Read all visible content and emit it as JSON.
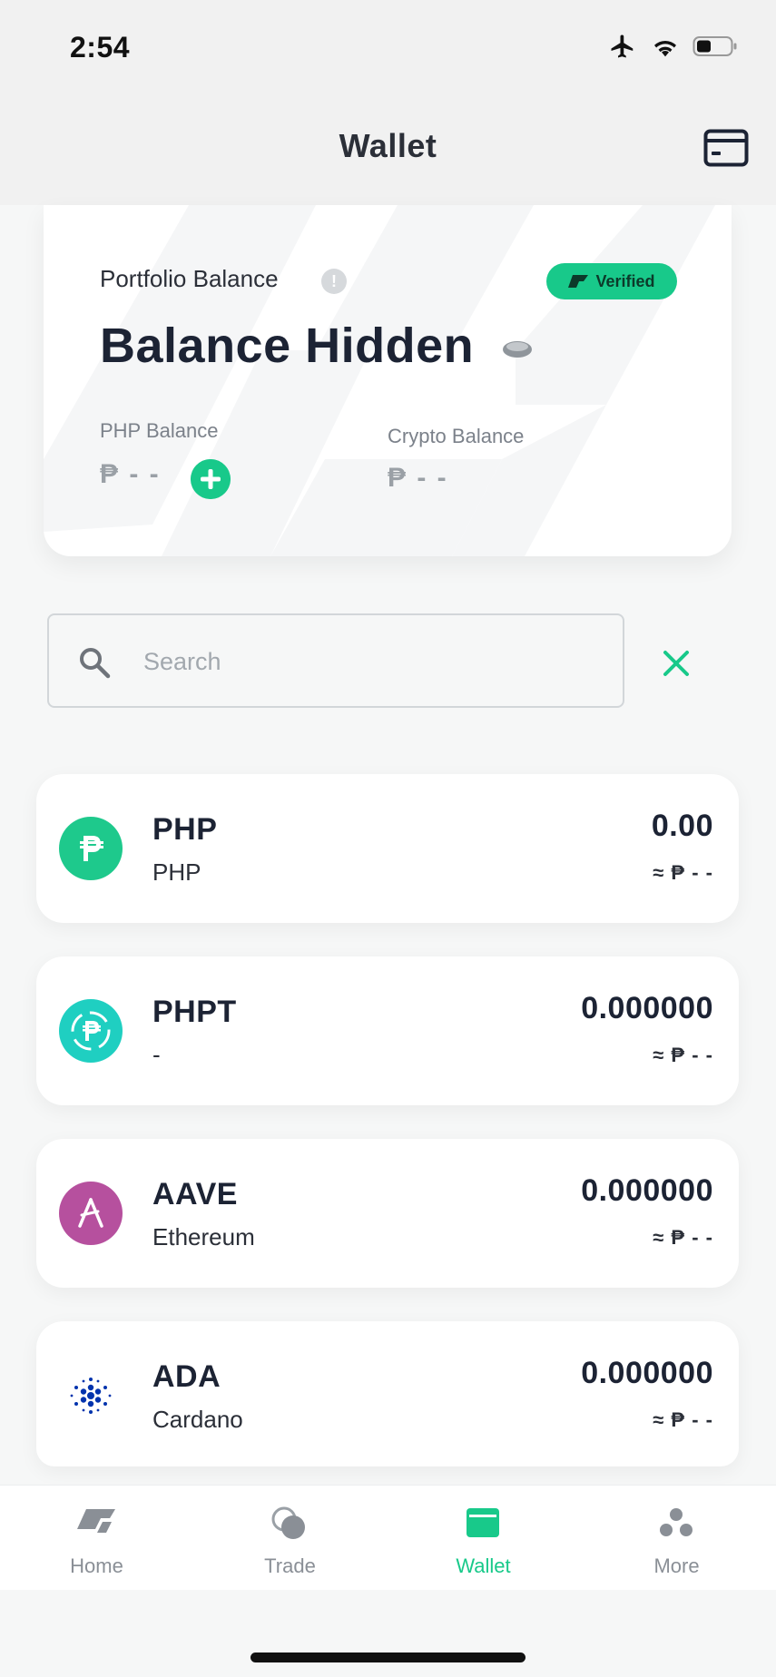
{
  "status_bar": {
    "time": "2:54"
  },
  "header": {
    "title": "Wallet"
  },
  "balance_card": {
    "portfolio_label": "Portfolio Balance",
    "info_glyph": "!",
    "verified_label": "Verified",
    "balance_text": "Balance Hidden",
    "php_balance_label": "PHP Balance",
    "php_balance_value": "₱ - -",
    "crypto_balance_label": "Crypto Balance",
    "crypto_balance_value": "₱ - -"
  },
  "search": {
    "placeholder": "Search",
    "value": ""
  },
  "assets": [
    {
      "symbol": "PHP",
      "name": "PHP",
      "amount": "0.00",
      "fiat": "≈ ₱ - -",
      "icon": "php-coin-icon",
      "color": "#1ec98c"
    },
    {
      "symbol": "PHPT",
      "name": "-",
      "amount": "0.000000",
      "fiat": "≈ ₱ - -",
      "icon": "phpt-coin-icon",
      "color": "#1fcfc1"
    },
    {
      "symbol": "AAVE",
      "name": "Ethereum",
      "amount": "0.000000",
      "fiat": "≈ ₱ - -",
      "icon": "aave-coin-icon",
      "color": "#b6509e"
    },
    {
      "symbol": "ADA",
      "name": "Cardano",
      "amount": "0.000000",
      "fiat": "≈ ₱ - -",
      "icon": "ada-coin-icon",
      "color": "#0033ad"
    }
  ],
  "bottom_nav": {
    "items": [
      {
        "label": "Home",
        "icon": "home-logo-icon",
        "active": false
      },
      {
        "label": "Trade",
        "icon": "trade-icon",
        "active": false
      },
      {
        "label": "Wallet",
        "icon": "wallet-icon",
        "active": true
      },
      {
        "label": "More",
        "icon": "more-icon",
        "active": false
      }
    ]
  },
  "colors": {
    "accent": "#18c98a",
    "text_primary": "#1c2334",
    "muted": "#8a8f96"
  }
}
